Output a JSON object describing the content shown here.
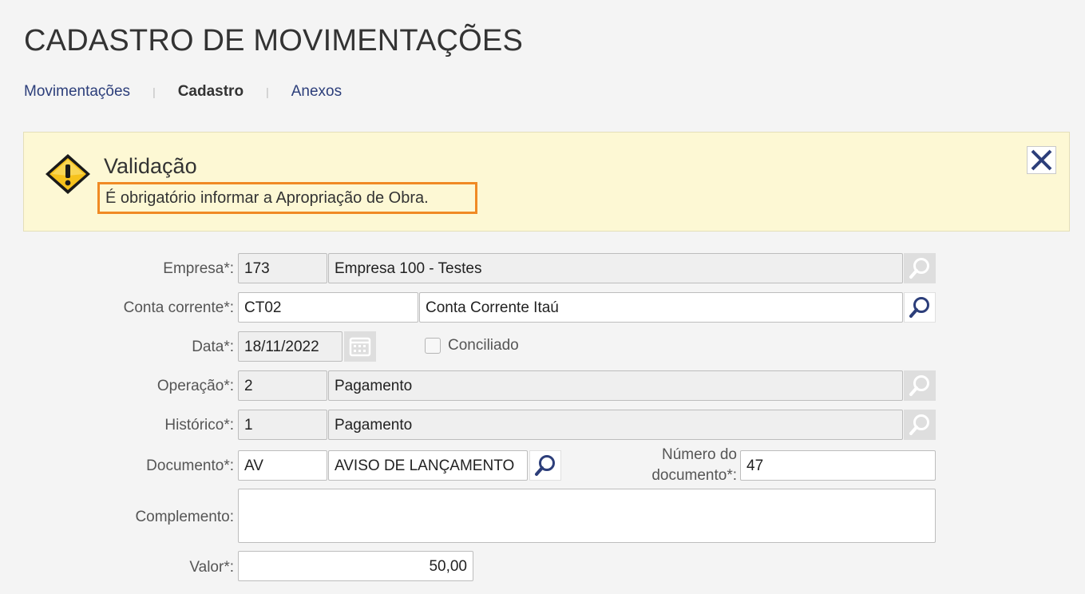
{
  "page": {
    "title": "CADASTRO DE MOVIMENTAÇÕES"
  },
  "tabs": [
    {
      "label": "Movimentações"
    },
    {
      "label": "Cadastro"
    },
    {
      "label": "Anexos"
    }
  ],
  "alert": {
    "title": "Validação",
    "message": "É obrigatório informar a Apropriação de Obra."
  },
  "form": {
    "empresa": {
      "label": "Empresa*:",
      "code": "173",
      "name": "Empresa 100 - Testes"
    },
    "conta": {
      "label": "Conta corrente*:",
      "code": "CT02",
      "name": "Conta Corrente Itaú"
    },
    "data": {
      "label": "Data*:",
      "value": "18/11/2022"
    },
    "conciliado": {
      "label": "Conciliado"
    },
    "operacao": {
      "label": "Operação*:",
      "code": "2",
      "name": "Pagamento"
    },
    "historico": {
      "label": "Histórico*:",
      "code": "1",
      "name": "Pagamento"
    },
    "documento": {
      "label": "Documento*:",
      "code": "AV",
      "name": "AVISO DE LANÇAMENTO"
    },
    "numero": {
      "label_line1": "Número do",
      "label_line2": "documento*:",
      "value": "47"
    },
    "complemento": {
      "label": "Complemento:",
      "value": ""
    },
    "valor": {
      "label": "Valor*:",
      "value": "50,00"
    }
  },
  "colors": {
    "accent": "#2c3e7a",
    "highlight": "#f08a24",
    "alert_bg": "#fdf8d4"
  }
}
